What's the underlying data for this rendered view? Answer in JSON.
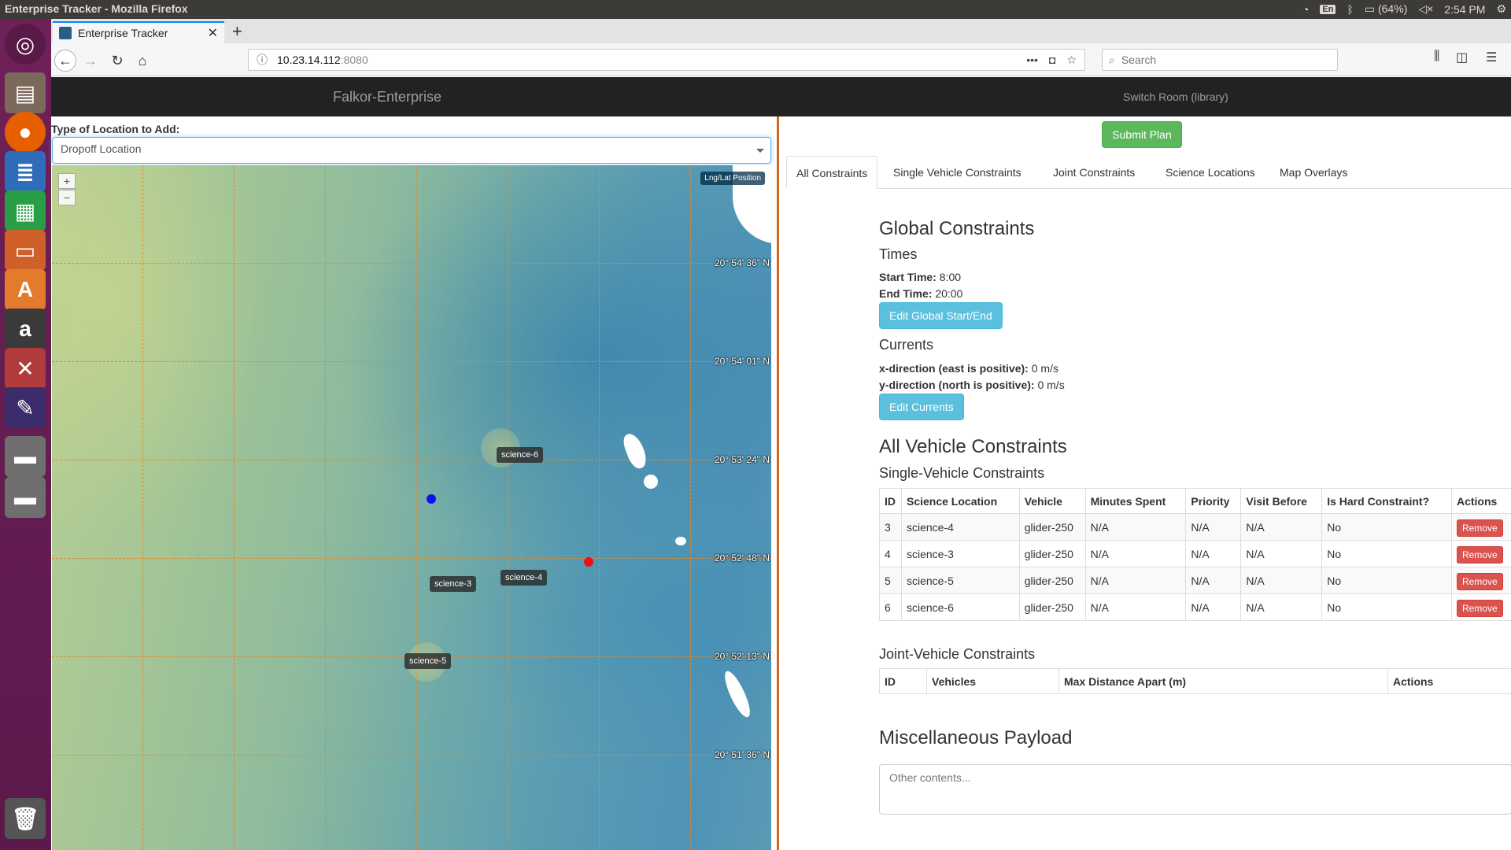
{
  "os": {
    "window_title": "Enterprise Tracker - Mozilla Firefox",
    "keyboard": "En",
    "battery": "(64%)",
    "clock": "2:54 PM"
  },
  "browser": {
    "tab_title": "Enterprise Tracker",
    "url_host": "10.23.14.112",
    "url_port": ":8080",
    "search_placeholder": "Search"
  },
  "app": {
    "brand": "Falkor-Enterprise",
    "switch_room": "Switch Room (library)"
  },
  "map_panel": {
    "location_type_label": "Type of Location to Add:",
    "location_type_value": "Dropoff Location",
    "zoom_in": "+",
    "zoom_out": "−",
    "lnglat_button": "Lng/Lat Position",
    "lat_labels": [
      "20° 54' 36\" N",
      "20° 54' 01\" N",
      "20° 53' 24\" N",
      "20° 52' 48\" N",
      "20° 52' 13\" N",
      "20° 51' 36\" N"
    ],
    "markers": [
      "science-6",
      "science-3",
      "science-4",
      "science-5"
    ]
  },
  "plan": {
    "submit": "Submit Plan",
    "tabs": [
      "All Constraints",
      "Single Vehicle Constraints",
      "Joint Constraints",
      "Science Locations",
      "Map Overlays"
    ],
    "global_title": "Global Constraints",
    "times_title": "Times",
    "start_label": "Start Time:",
    "start_value": "8:00",
    "end_label": "End Time:",
    "end_value": "20:00",
    "edit_global": "Edit Global Start/End",
    "currents_title": "Currents",
    "x_label": "x-direction (east is positive):",
    "x_value": "0 m/s",
    "y_label": "y-direction (north is positive):",
    "y_value": "0 m/s",
    "edit_currents": "Edit Currents",
    "all_vehicle_title": "All Vehicle Constraints",
    "single_title": "Single-Vehicle Constraints",
    "single_headers": [
      "ID",
      "Science Location",
      "Vehicle",
      "Minutes Spent",
      "Priority",
      "Visit Before",
      "Is Hard Constraint?",
      "Actions"
    ],
    "single_rows": [
      [
        "3",
        "science-4",
        "glider-250",
        "N/A",
        "N/A",
        "N/A",
        "No",
        "Remove"
      ],
      [
        "4",
        "science-3",
        "glider-250",
        "N/A",
        "N/A",
        "N/A",
        "No",
        "Remove"
      ],
      [
        "5",
        "science-5",
        "glider-250",
        "N/A",
        "N/A",
        "N/A",
        "No",
        "Remove"
      ],
      [
        "6",
        "science-6",
        "glider-250",
        "N/A",
        "N/A",
        "N/A",
        "No",
        "Remove"
      ]
    ],
    "joint_title": "Joint-Vehicle Constraints",
    "joint_headers": [
      "ID",
      "Vehicles",
      "Max Distance Apart (m)",
      "Actions"
    ],
    "misc_title": "Miscellaneous Payload",
    "misc_placeholder": "Other contents..."
  }
}
